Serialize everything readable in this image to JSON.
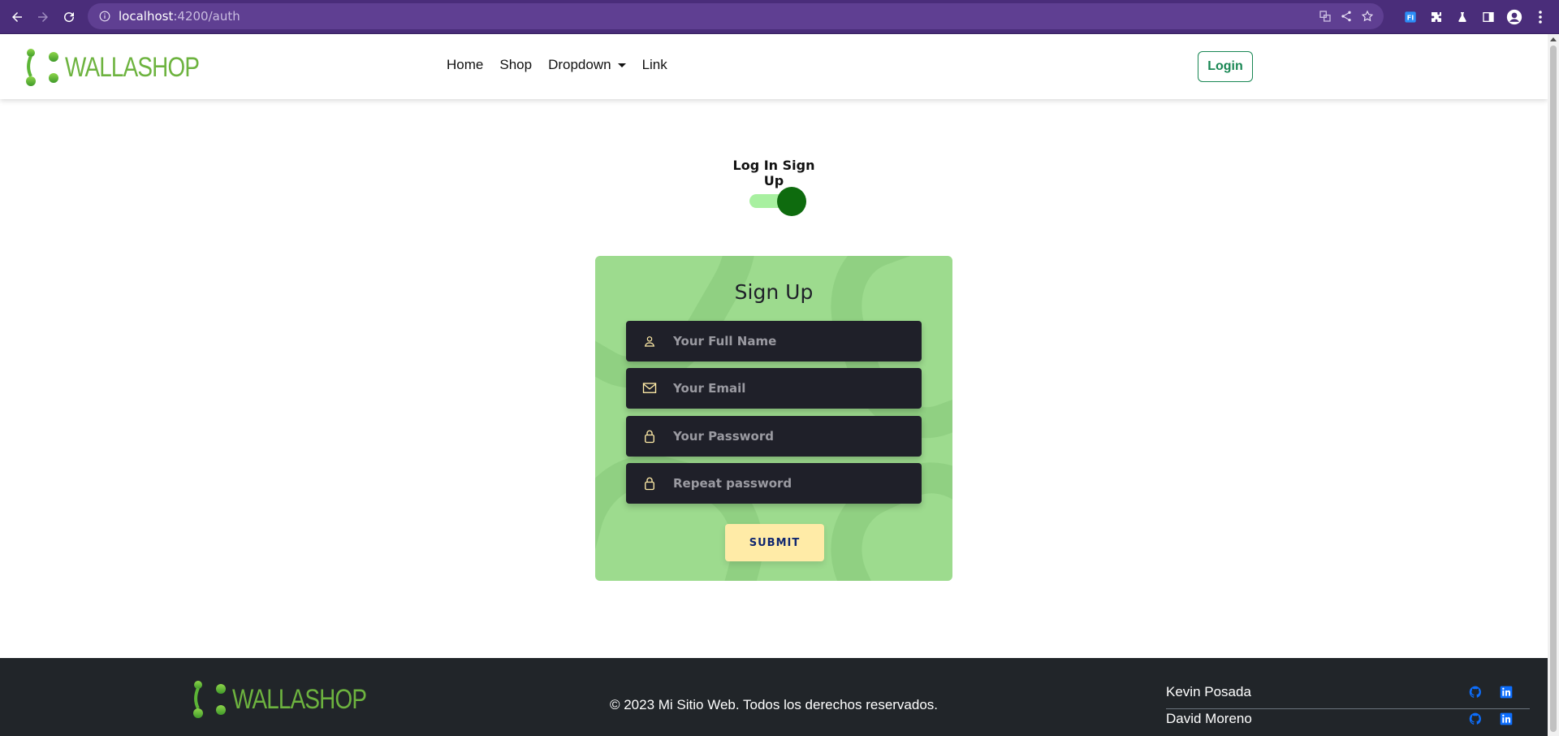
{
  "browser": {
    "url_host": "localhost",
    "url_path": ":4200/auth"
  },
  "navbar": {
    "brand": "WALLASHOP",
    "links": [
      {
        "label": "Home"
      },
      {
        "label": "Shop"
      },
      {
        "label": "Dropdown"
      },
      {
        "label": "Link"
      }
    ],
    "login_label": "Login"
  },
  "auth": {
    "toggle_label": "Log In Sign Up",
    "toggle_checked": true,
    "card_title": "Sign Up",
    "fields": [
      {
        "placeholder": "Your Full Name",
        "icon": "user-icon"
      },
      {
        "placeholder": "Your Email",
        "icon": "envelope-icon"
      },
      {
        "placeholder": "Your Password",
        "icon": "lock-icon"
      },
      {
        "placeholder": "Repeat password",
        "icon": "lock-icon"
      }
    ],
    "submit_label": "SUBMIT"
  },
  "footer": {
    "brand": "WALLASHOP",
    "copyright": "© 2023 Mi Sitio Web. Todos los derechos reservados.",
    "authors": [
      {
        "name": "Kevin Posada"
      },
      {
        "name": "David Moreno"
      }
    ]
  },
  "colors": {
    "brand_green": "#6db33f",
    "login_green": "#198754",
    "card_bg": "#9ddb8e",
    "field_bg": "#1f2029",
    "accent_yellow": "#ffeba7",
    "toggle_knob": "#0e6b0e",
    "footer_bg": "#212529",
    "chrome_purple": "#4a2d7a"
  }
}
